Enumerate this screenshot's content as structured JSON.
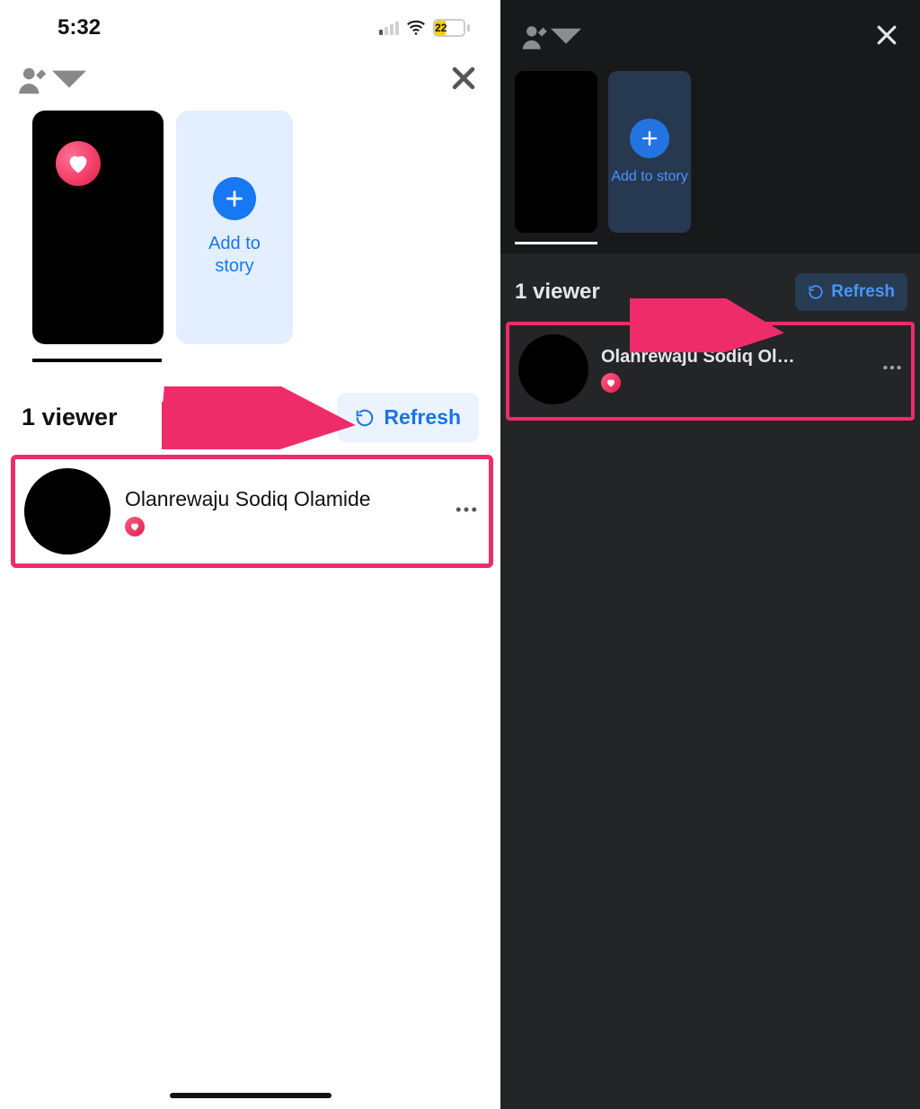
{
  "status_bar": {
    "time": "5:32",
    "battery": "22",
    "signal_active_bars": 1
  },
  "light": {
    "add_to_story_label": "Add to\nstory",
    "viewers_label": "1 viewer",
    "refresh_label": "Refresh",
    "viewer": {
      "name": "Olanrewaju Sodiq Olamide"
    }
  },
  "dark": {
    "add_to_story_label": "Add to story",
    "viewers_label": "1 viewer",
    "refresh_label": "Refresh",
    "viewer": {
      "name": "Olanrewaju Sodiq Ol…"
    }
  },
  "icons": {
    "close": "×",
    "more": "•••"
  }
}
